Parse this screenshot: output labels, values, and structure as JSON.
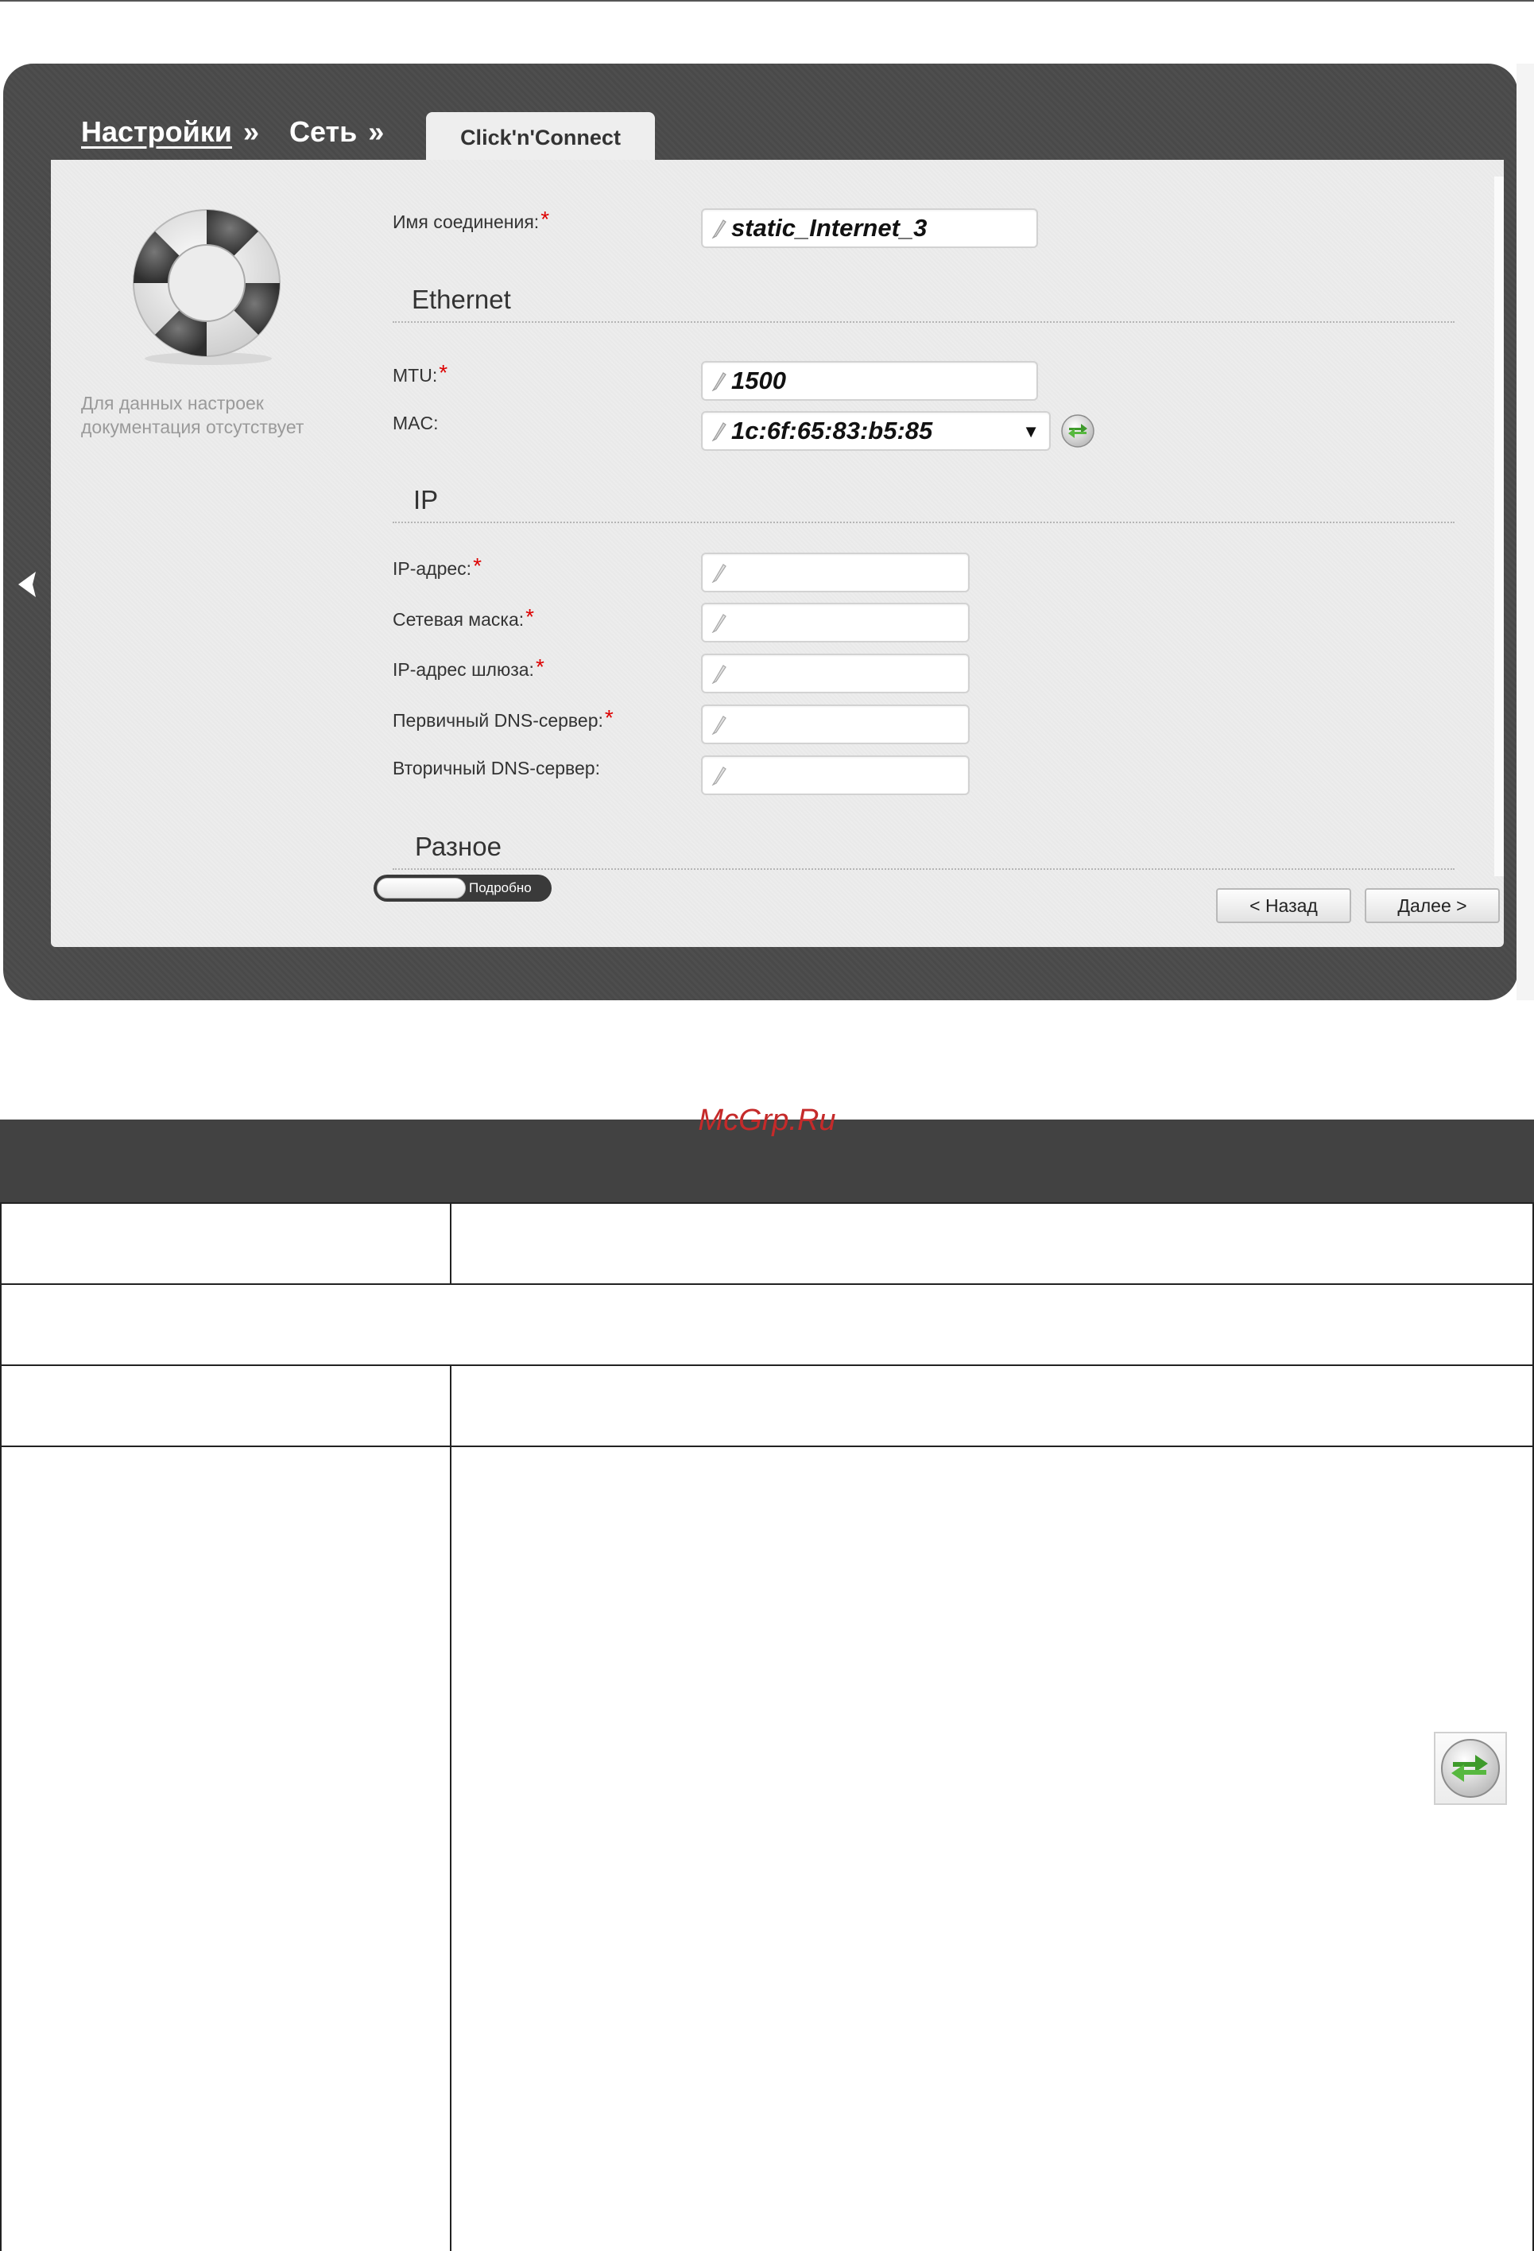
{
  "breadcrumb": {
    "items": [
      "Настройки",
      "Сеть"
    ],
    "separator": "»",
    "active_tab": "Click'n'Connect"
  },
  "help": {
    "text": "Для данных настроек документация отсутствует"
  },
  "form": {
    "connection_name": {
      "label": "Имя соединения:",
      "value": "static_Internet_3",
      "required": "*"
    },
    "ethernet": {
      "title": "Ethernet",
      "mtu": {
        "label": "MTU:",
        "value": "1500",
        "required": "*"
      },
      "mac": {
        "label": "MAC:",
        "value": "1c:6f:65:83:b5:85",
        "dropdown_glyph": "▼"
      }
    },
    "ip": {
      "title": "IP",
      "fields": [
        {
          "label": "IP-адрес:",
          "value": "",
          "required": "*"
        },
        {
          "label": "Сетевая маска:",
          "value": "",
          "required": "*"
        },
        {
          "label": "IP-адрес шлюза:",
          "value": "",
          "required": "*"
        },
        {
          "label": "Первичный DNS-сервер:",
          "value": "",
          "required": "*"
        },
        {
          "label": "Вторичный DNS-сервер:",
          "value": "",
          "required": ""
        }
      ]
    },
    "misc": {
      "title": "Разное"
    },
    "details_toggle": {
      "label": "Подробно",
      "state": "off"
    }
  },
  "buttons": {
    "back": "< Назад",
    "next": "Далее >"
  },
  "icons": {
    "collapse": "chevron-left-icon",
    "help": "lifebuoy-icon",
    "edit": "pencil-icon",
    "clone_mac": "refresh-arrows-icon"
  },
  "colors": {
    "frame": "#4a4a4a",
    "panel": "#ececec",
    "required": "#dd0000",
    "watermark": "#c52a2a",
    "table_header": "#424242",
    "icon_green": "#3e9a2b"
  },
  "document": {
    "watermark": "McGrp.Ru"
  }
}
